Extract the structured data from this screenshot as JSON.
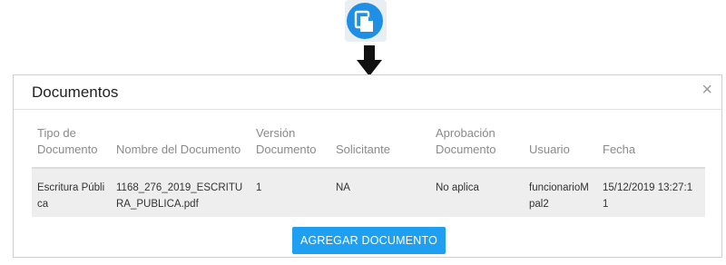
{
  "modal": {
    "title": "Documentos",
    "close": "×"
  },
  "table": {
    "headers": [
      "Tipo de\nDocumento",
      "Nombre del Documento",
      "Versión\nDocumento",
      "Solicitante",
      "Aprobación\nDocumento",
      "Usuario",
      "Fecha"
    ],
    "rows": [
      {
        "tipo": "Escritura Públi\nca",
        "nombre": "1168_276_2019_ESCRITU\nRA_PUBLICA.pdf",
        "version": "1",
        "solicitante": "NA",
        "aprobacion": "No aplica",
        "usuario": "funcionarioM\npal2",
        "fecha": "15/12/2019 13:27:1\n1"
      }
    ]
  },
  "actions": {
    "add_document": "AGREGAR DOCUMENTO"
  },
  "icons": {
    "top": "document-copy-icon",
    "arrow": "arrow-down-icon"
  },
  "colors": {
    "accent": "#1e9ff2",
    "icon_bg": "#1e8fe4",
    "row_bg": "#eeeeee"
  }
}
